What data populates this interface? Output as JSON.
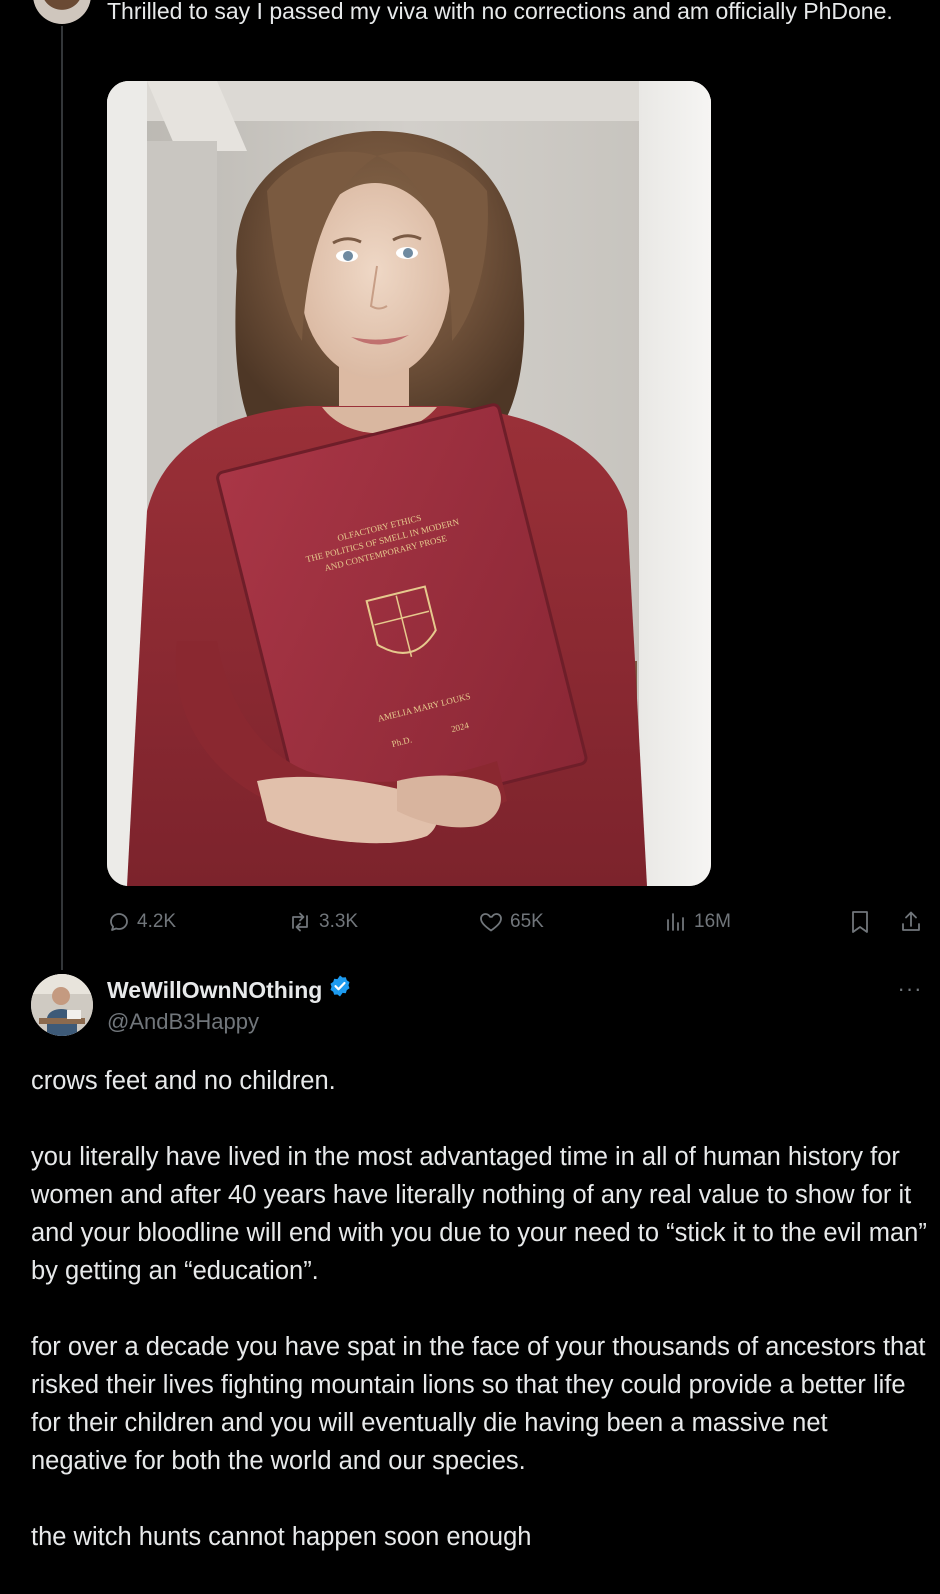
{
  "original_tweet": {
    "text": "Thrilled to say I passed my viva with no corrections and am officially PhDone.",
    "media": {
      "thesis_cover": {
        "title_line1": "OLFACTORY ETHICS",
        "title_line2": "THE POLITICS OF SMELL IN MODERN",
        "title_line3": "AND CONTEMPORARY PROSE",
        "author": "AMELIA MARY LOUKS",
        "degree": "Ph.D.",
        "year": "2024"
      }
    },
    "stats": {
      "replies": "4.2K",
      "reposts": "3.3K",
      "likes": "65K",
      "views": "16M"
    }
  },
  "reply": {
    "display_name": "WeWillOwnNOthing",
    "handle": "@AndB3Happy",
    "verified": true,
    "more_label": "···",
    "paragraphs": [
      "crows feet and no children.",
      "you literally have lived in the most advantaged time in all of human history for women and after 40 years have literally nothing of any real value to show for it and your bloodline will end with you due to your need to “stick it to the evil man” by getting an “education”.",
      "for over a decade you have spat in the face of your thousands of ancestors that risked their lives fighting mountain lions so that they could provide a better life for their children and you will eventually die having been a massive net negative for both the world and our species.",
      "the witch hunts cannot happen soon enough"
    ]
  },
  "colors": {
    "background": "#000000",
    "text_primary": "#e7e9ea",
    "text_secondary": "#71767b",
    "verified_badge": "#1d9bf0",
    "thesis_cover": "#9a2f3d",
    "sweater": "#8e2a33"
  },
  "icons": {
    "reply": "reply-icon",
    "repost": "repost-icon",
    "like": "heart-icon",
    "views": "views-icon",
    "bookmark": "bookmark-icon",
    "share": "share-icon",
    "verified": "verified-badge-icon"
  }
}
